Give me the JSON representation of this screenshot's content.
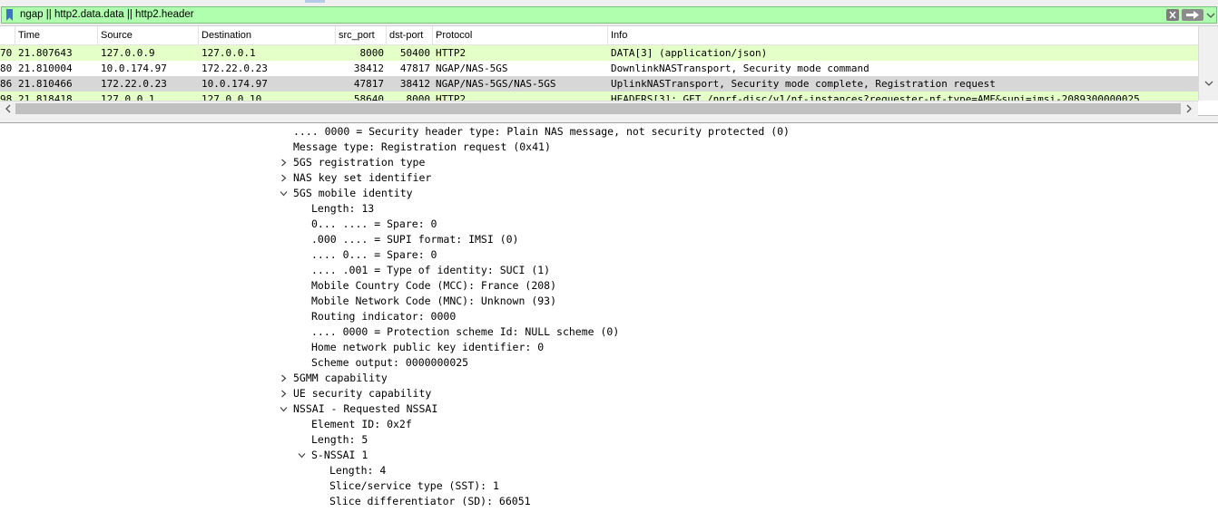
{
  "filter": {
    "value": "ngap || http2.data.data || http2.header",
    "colors": {
      "valid_bg": "#afffaf"
    },
    "icons": [
      "bookmark-icon",
      "clear-icon",
      "apply-arrow-icon",
      "dropdown-arrow-icon"
    ]
  },
  "packet_list": {
    "columns": [
      "Time",
      "Source",
      "Destination",
      "src_port",
      "dst-port",
      "Protocol",
      "Info"
    ],
    "rows": [
      {
        "no": "70",
        "time": "21.807643",
        "source": "127.0.0.9",
        "destination": "127.0.0.1",
        "src_port": "8000",
        "dst_port": "50400",
        "protocol": "HTTP2",
        "info": "DATA[3] (application/json)",
        "bg": "#e4ffc7"
      },
      {
        "no": "80",
        "time": "21.810004",
        "source": "10.0.174.97",
        "destination": "172.22.0.23",
        "src_port": "38412",
        "dst_port": "47817",
        "protocol": "NGAP/NAS-5GS",
        "info": "DownlinkNASTransport, Security mode command",
        "bg": "#ffffff"
      },
      {
        "no": "86",
        "time": "21.810466",
        "source": "172.22.0.23",
        "destination": "10.0.174.97",
        "src_port": "47817",
        "dst_port": "38412",
        "protocol": "NGAP/NAS-5GS/NAS-5GS",
        "info": "UplinkNASTransport, Security mode complete, Registration request",
        "bg": "#d7d7d7"
      },
      {
        "no": "98",
        "time": "21.818418",
        "source": "127.0.0.1",
        "destination": "127.0.0.10",
        "src_port": "58640",
        "dst_port": "8000",
        "protocol": "HTTP2",
        "info": "HEADERS[3]: GET /nnrf-disc/v1/nf-instances?requester-nf-type=AMF&supi=imsi-2089300000025…",
        "bg": "#e4ffc7"
      }
    ]
  },
  "details": {
    "lines": [
      {
        "text": ".... 0000 = Security header type: Plain NAS message, not security protected (0)",
        "indent": 0,
        "state": "none"
      },
      {
        "text": "Message type: Registration request (0x41)",
        "indent": 0,
        "state": "none"
      },
      {
        "text": "5GS registration type",
        "indent": 0,
        "state": "collapsed"
      },
      {
        "text": "NAS key set identifier",
        "indent": 0,
        "state": "collapsed"
      },
      {
        "text": "5GS mobile identity",
        "indent": 0,
        "state": "expanded"
      },
      {
        "text": "Length: 13",
        "indent": 1,
        "state": "none"
      },
      {
        "text": "0... .... = Spare: 0",
        "indent": 1,
        "state": "none"
      },
      {
        "text": ".000 .... = SUPI format: IMSI (0)",
        "indent": 1,
        "state": "none"
      },
      {
        "text": ".... 0... = Spare: 0",
        "indent": 1,
        "state": "none"
      },
      {
        "text": ".... .001 = Type of identity: SUCI (1)",
        "indent": 1,
        "state": "none"
      },
      {
        "text": "Mobile Country Code (MCC): France (208)",
        "indent": 1,
        "state": "none"
      },
      {
        "text": "Mobile Network Code (MNC): Unknown (93)",
        "indent": 1,
        "state": "none"
      },
      {
        "text": "Routing indicator: 0000",
        "indent": 1,
        "state": "none"
      },
      {
        "text": ".... 0000 = Protection scheme Id: NULL scheme (0)",
        "indent": 1,
        "state": "none"
      },
      {
        "text": "Home network public key identifier: 0",
        "indent": 1,
        "state": "none"
      },
      {
        "text": "Scheme output: 0000000025",
        "indent": 1,
        "state": "none"
      },
      {
        "text": "5GMM capability",
        "indent": 0,
        "state": "collapsed"
      },
      {
        "text": "UE security capability",
        "indent": 0,
        "state": "collapsed"
      },
      {
        "text": "NSSAI - Requested NSSAI",
        "indent": 0,
        "state": "expanded"
      },
      {
        "text": "Element ID: 0x2f",
        "indent": 1,
        "state": "none"
      },
      {
        "text": "Length: 5",
        "indent": 1,
        "state": "none"
      },
      {
        "text": "S-NSSAI 1",
        "indent": 1,
        "state": "expanded"
      },
      {
        "text": "Length: 4",
        "indent": 2,
        "state": "none"
      },
      {
        "text": "Slice/service type (SST): 1",
        "indent": 2,
        "state": "none"
      },
      {
        "text": "Slice differentiator (SD): 66051",
        "indent": 2,
        "state": "none"
      }
    ]
  }
}
